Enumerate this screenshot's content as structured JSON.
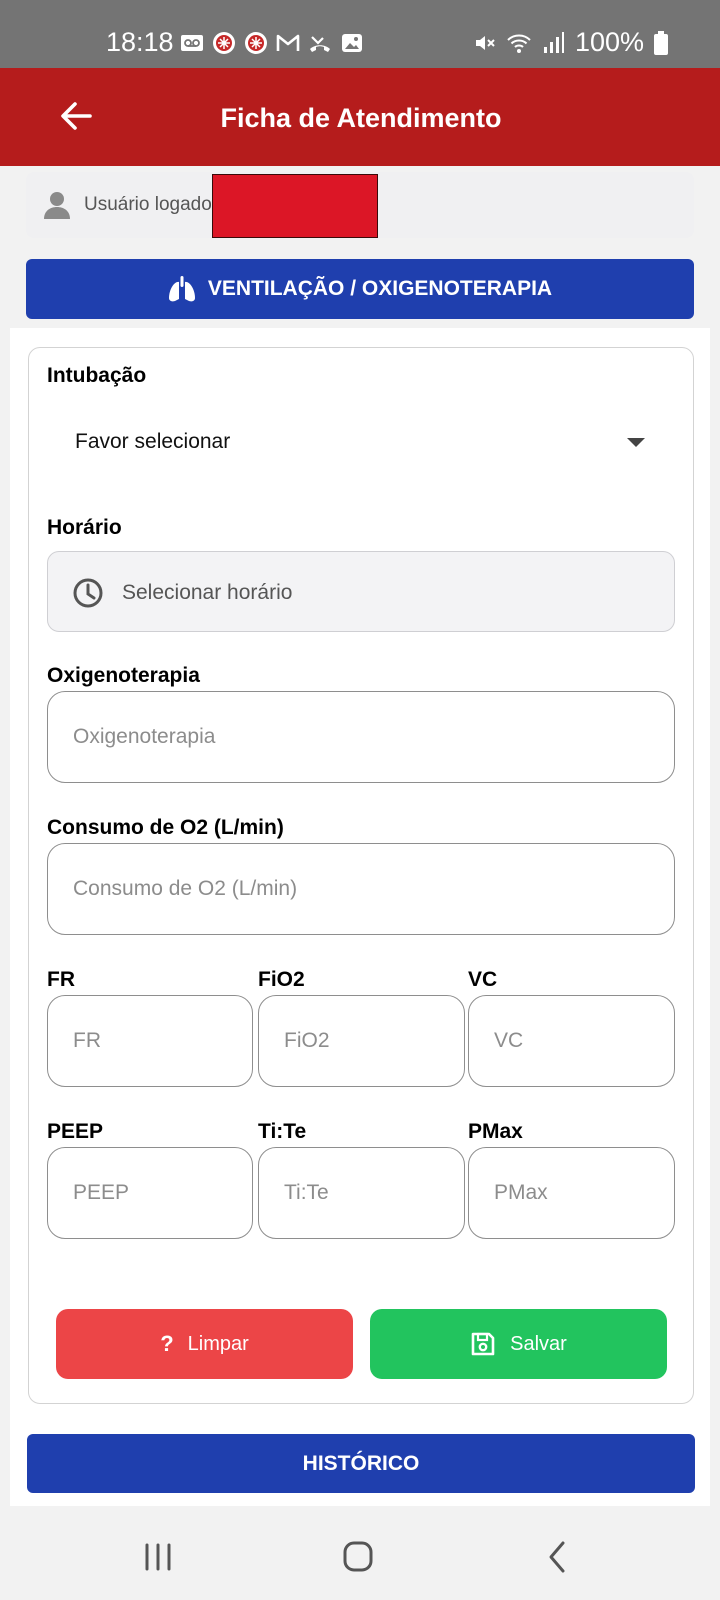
{
  "status_bar": {
    "time": "18:18",
    "battery": "100%",
    "left_icons": [
      "voicemail-icon",
      "app-badge-icon",
      "app-badge-icon",
      "gmail-icon",
      "missed-call-icon",
      "gallery-icon"
    ],
    "right_icons": [
      "mute-icon",
      "wifi-icon",
      "signal-icon",
      "battery-icon"
    ]
  },
  "header": {
    "title": "Ficha de Atendimento",
    "back_icon": "arrow-left-icon",
    "background": "#b51c1c"
  },
  "user": {
    "label": "Usuário logado"
  },
  "section": {
    "title": "VENTILAÇÃO / OXIGENOTERAPIA",
    "icon": "lungs-icon",
    "background": "#1f3fae"
  },
  "form": {
    "intubacao": {
      "label": "Intubação",
      "value": "Favor selecionar"
    },
    "horario": {
      "label": "Horário",
      "placeholder": "Selecionar horário"
    },
    "oxigenoterapia": {
      "label": "Oxigenoterapia",
      "placeholder": "Oxigenoterapia"
    },
    "consumo_o2": {
      "label": "Consumo de O2 (L/min)",
      "placeholder": "Consumo de O2 (L/min)"
    },
    "fr": {
      "label": "FR",
      "placeholder": "FR"
    },
    "fio2": {
      "label": "FiO2",
      "placeholder": "FiO2"
    },
    "vc": {
      "label": "VC",
      "placeholder": "VC"
    },
    "peep": {
      "label": "PEEP",
      "placeholder": "PEEP"
    },
    "tite": {
      "label": "Ti:Te",
      "placeholder": "Ti:Te"
    },
    "pmax": {
      "label": "PMax",
      "placeholder": "PMax"
    }
  },
  "actions": {
    "clear_label": "Limpar",
    "clear_icon_glyph": "?",
    "clear_color": "#ec4547",
    "save_label": "Salvar",
    "save_color": "#22c45e"
  },
  "history": {
    "label": "HISTÓRICO"
  },
  "nav_bar": {
    "buttons": [
      "recent-apps-icon",
      "home-icon",
      "back-icon"
    ]
  }
}
